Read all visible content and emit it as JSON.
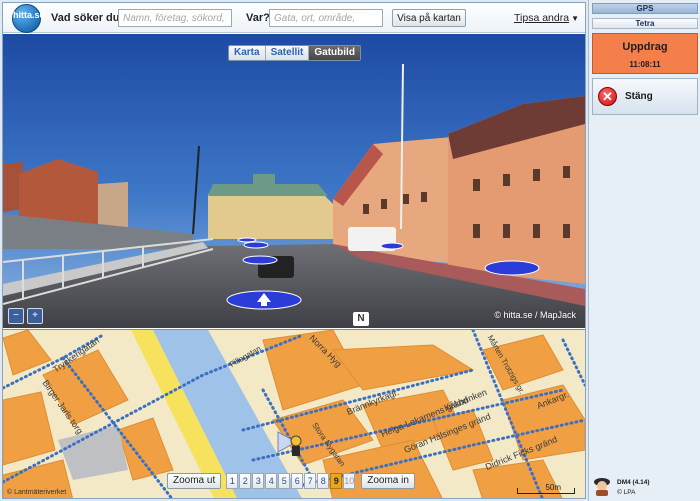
{
  "header": {
    "logo_text": "hitta.se",
    "what_label": "Vad söker du?",
    "what_placeholder": "Namn, företag, sökord,",
    "where_label": "Var?",
    "where_placeholder": "Gata, ort, område,",
    "show_map_button": "Visa på kartan",
    "tips_link": "Tipsa andra"
  },
  "street_view": {
    "tabs": [
      "Karta",
      "Satellit",
      "Gatubild"
    ],
    "active_tab": "Gatubild",
    "credit": "© hitta.se / MapJack",
    "compass": "N",
    "zoom_out_symbol": "−",
    "zoom_in_symbol": "+"
  },
  "map": {
    "street_names": [
      "Tryckerigatan",
      "Birger Jarls torg",
      "Norra Hyg",
      "Stora Nygatan",
      "Fillegatan",
      "Brännkyrkagr.",
      "Helga Lekamens gränd",
      "Göran Hälsinges gränd",
      "Kåkbrinken",
      "Didrick Ficks gränd",
      "Mårten Trotzigs gr.",
      "Ankargr."
    ],
    "zoom_out_button": "Zooma ut",
    "zoom_in_button": "Zooma in",
    "zoom_levels": [
      "1",
      "2",
      "3",
      "4",
      "5",
      "6",
      "7",
      "8",
      "9",
      "10"
    ],
    "selected_level": "9",
    "copyright": "© Lantmäteriverket",
    "scale_label": "50m"
  },
  "panel": {
    "gps": "GPS",
    "tetra": "Tetra",
    "uppdrag_title": "Uppdrag",
    "uppdrag_time": "11:08:11",
    "close_button": "Stäng",
    "version": "DM4 (4.14)",
    "vendor": "© LPA"
  },
  "colors": {
    "uppdrag_bg": "#f47f4a",
    "map_building": "#f0a043",
    "map_water": "#9fc3e8",
    "map_route": "#3b6fc4",
    "selected_zoom": "#e9a617"
  }
}
